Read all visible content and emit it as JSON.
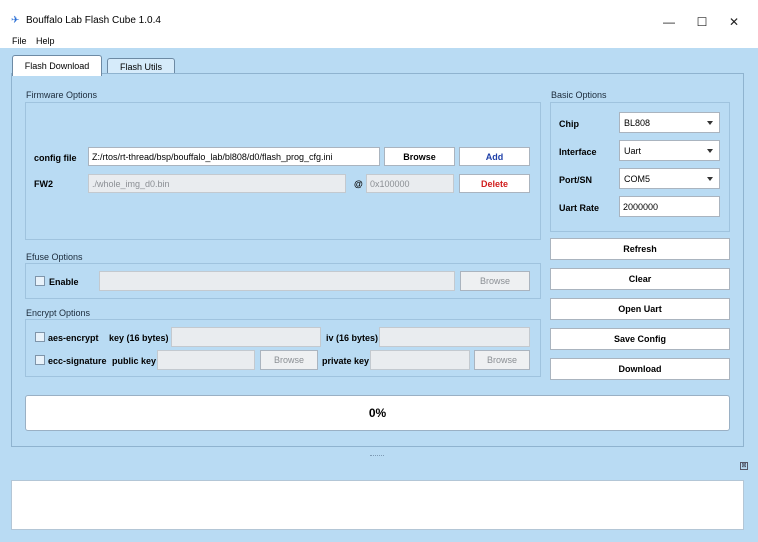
{
  "window": {
    "title": "Bouffalo Lab Flash Cube 1.0.4",
    "minimize": "—",
    "maximize": "☐",
    "close": "✕"
  },
  "menu": {
    "file": "File",
    "help": "Help"
  },
  "tabs": [
    {
      "label": "Flash Download",
      "active": true
    },
    {
      "label": "Flash Utils",
      "active": false
    }
  ],
  "firmware": {
    "section_label": "Firmware Options",
    "config_label": "config file",
    "config_value": "Z:/rtos/rt-thread/bsp/bouffalo_lab/bl808/d0/flash_prog_cfg.ini",
    "browse_label": "Browse",
    "add_label": "Add",
    "fw_label": "FW2",
    "fw_value": "./whole_img_d0.bin",
    "at_symbol": "@",
    "address_value": "0x100000",
    "delete_label": "Delete"
  },
  "efuse": {
    "section_label": "Efuse Options",
    "enable_label": "Enable",
    "browse_label": "Browse"
  },
  "encrypt": {
    "section_label": "Encrypt Options",
    "aes_label": "aes-encrypt",
    "key_label": "key (16 bytes)",
    "iv_label": "iv (16 bytes)",
    "ecc_label": "ecc-signature",
    "public_key_label": "public key",
    "browse_label": "Browse",
    "private_key_label": "private key",
    "browse2_label": "Browse"
  },
  "basic": {
    "section_label": "Basic Options",
    "chip_label": "Chip",
    "chip_value": "BL808",
    "interface_label": "Interface",
    "interface_value": "Uart",
    "port_label": "Port/SN",
    "port_value": "COM5",
    "baud_label": "Uart Rate",
    "baud_value": "2000000"
  },
  "actions": {
    "refresh": "Refresh",
    "clear": "Clear",
    "open_uart": "Open Uart",
    "save_config": "Save Config",
    "download": "Download"
  },
  "progress": {
    "text": "0%",
    "value": 0
  }
}
